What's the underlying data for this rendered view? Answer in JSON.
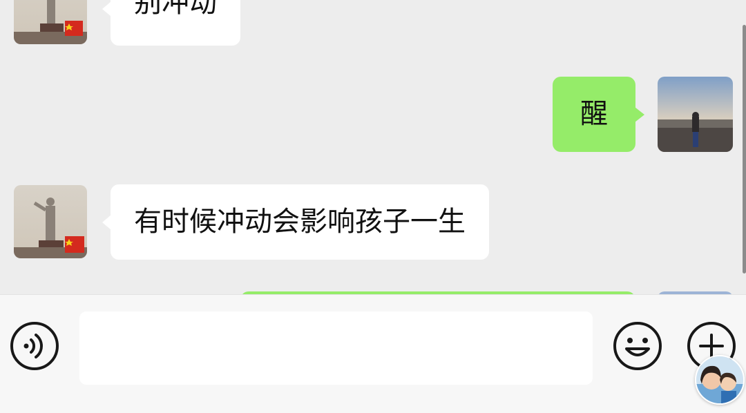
{
  "messages": [
    {
      "direction": "in",
      "text": "别冲动",
      "avatar": "statue-avatar"
    },
    {
      "direction": "out",
      "text": "醒",
      "avatar": "landscape-avatar"
    },
    {
      "direction": "in",
      "text": "有时候冲动会影响孩子一生",
      "avatar": "statue-avatar"
    },
    {
      "direction": "out",
      "text": "",
      "avatar": "landscape-avatar"
    }
  ],
  "input": {
    "value": "",
    "placeholder": ""
  },
  "icons": {
    "voice": "voice-icon",
    "emoji": "emoji-icon",
    "plus": "plus-icon"
  },
  "colors": {
    "background": "#ededed",
    "incoming_bubble": "#ffffff",
    "outgoing_bubble": "#95ec69",
    "input_bar": "#f7f7f7",
    "icon": "#181818"
  }
}
